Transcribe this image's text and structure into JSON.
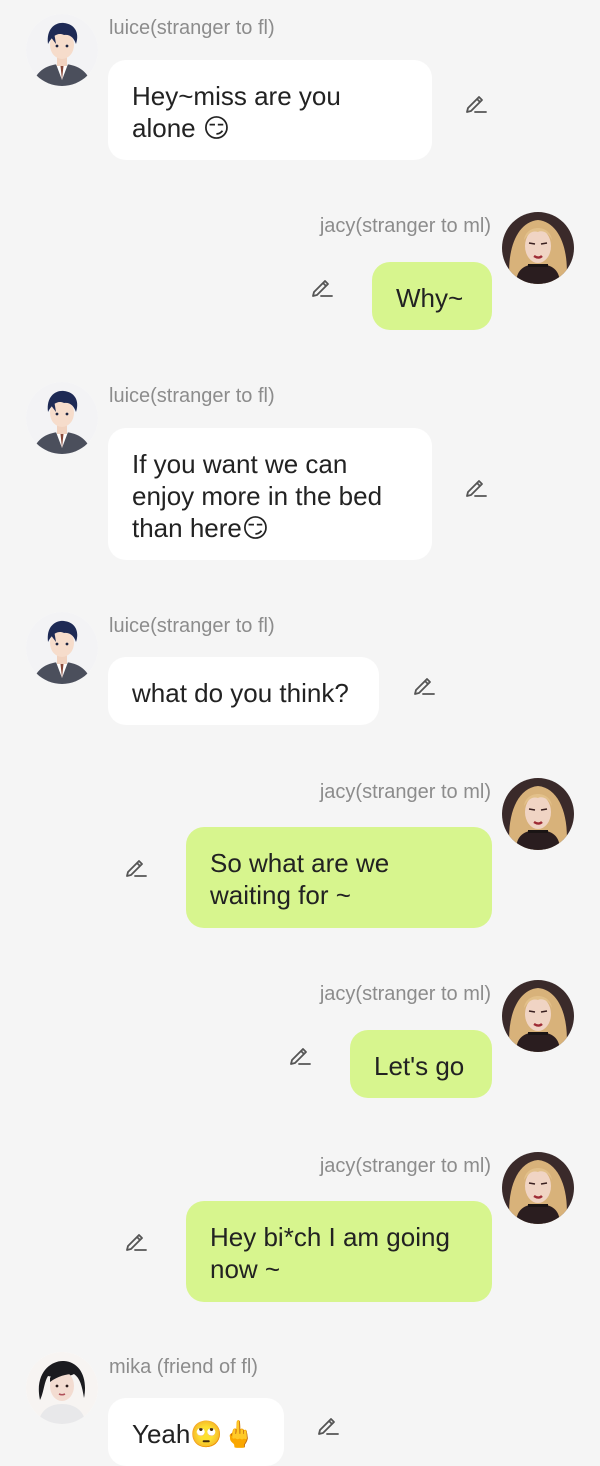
{
  "colors": {
    "background": "#f5f5f5",
    "left_bubble": "#ffffff",
    "right_bubble": "#d7f58e",
    "name_text": "#8c8c8c",
    "message_text": "#222222"
  },
  "messages": [
    {
      "sender": "luice(stranger to fl)",
      "avatar": "man-suit-avatar",
      "side": "left",
      "text": "Hey~miss are you alone 😏"
    },
    {
      "sender": "jacy(stranger to ml)",
      "avatar": "blonde-woman-avatar",
      "side": "right",
      "text": "Why~"
    },
    {
      "sender": "luice(stranger to fl)",
      "avatar": "man-suit-avatar",
      "side": "left",
      "text": "If you want we can enjoy more in the bed than here😏"
    },
    {
      "sender": "luice(stranger to fl)",
      "avatar": "man-suit-avatar",
      "side": "left",
      "text": "what do you think?"
    },
    {
      "sender": "jacy(stranger to ml)",
      "avatar": "blonde-woman-avatar",
      "side": "right",
      "text": "So what are we waiting for ~"
    },
    {
      "sender": "jacy(stranger to ml)",
      "avatar": "blonde-woman-avatar",
      "side": "right",
      "text": "Let's go"
    },
    {
      "sender": "jacy(stranger to ml)",
      "avatar": "blonde-woman-avatar",
      "side": "right",
      "text": "Hey bi*ch I am going now ~"
    },
    {
      "sender": "mika (friend of fl)",
      "avatar": "dark-hair-woman-avatar",
      "side": "left",
      "text": "Yeah🙄🖕"
    }
  ]
}
